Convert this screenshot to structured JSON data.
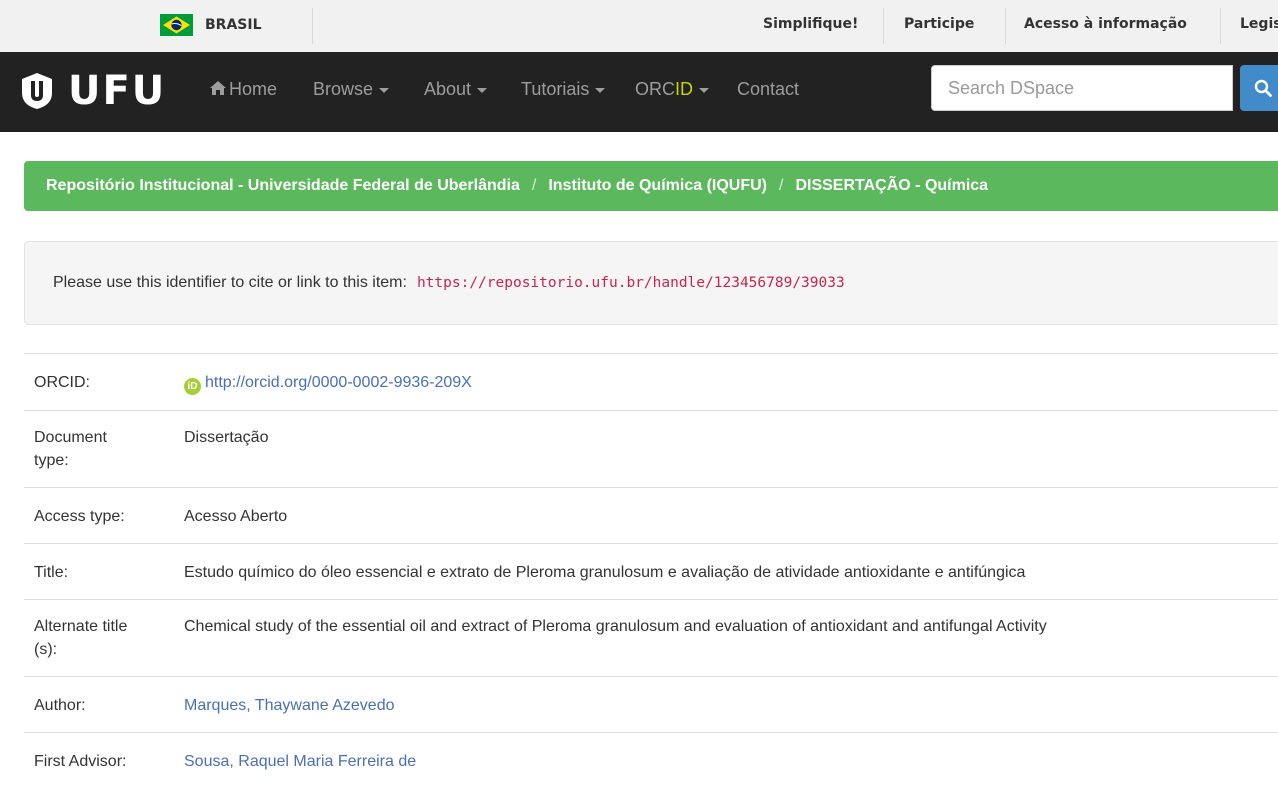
{
  "gov_bar": {
    "country": "BRASIL",
    "links": [
      "Simplifique!",
      "Participe",
      "Acesso à informação",
      "Legislação"
    ]
  },
  "navbar": {
    "logo": "UFU",
    "items": {
      "home": "Home",
      "browse": "Browse",
      "about": "About",
      "tutoriais": "Tutoriais",
      "orcid_prefix": "ORC",
      "orcid_suffix": "ID",
      "contact": "Contact"
    },
    "search_placeholder": "Search DSpace"
  },
  "breadcrumb": {
    "items": [
      "Repositório Institucional - Universidade Federal de Uberlândia",
      "Instituto de Química (IQUFU)",
      "DISSERTAÇÃO - Química"
    ],
    "separator": "/"
  },
  "cite": {
    "text": "Please use this identifier to cite or link to this item:",
    "url": "https://repositorio.ufu.br/handle/123456789/39033"
  },
  "metadata": {
    "orcid": {
      "label": "ORCID:",
      "value": "http://orcid.org/0000-0002-9936-209X"
    },
    "doc_type": {
      "label_line1": "Document",
      "label_line2": "type:",
      "value": "Dissertação"
    },
    "access_type": {
      "label": "Access type:",
      "value": "Acesso Aberto"
    },
    "title": {
      "label": "Title:",
      "value": "Estudo químico do óleo essencial e extrato de Pleroma granulosum e avaliação de atividade antioxidante e antifúngica"
    },
    "alt_title": {
      "label_line1": "Alternate title",
      "label_line2": "(s):",
      "value": "Chemical study of the essential oil and extract of Pleroma granulosum and evaluation of antioxidant and antifungal Activity"
    },
    "author": {
      "label": "Author:",
      "value": "Marques, Thaywane Azevedo"
    },
    "first_advisor": {
      "label": "First Advisor:",
      "value": "Sousa, Raquel Maria Ferreira de"
    }
  },
  "colors": {
    "navbar_bg": "#222222",
    "breadcrumb_bg": "#5cb85c",
    "link": "#4a6fb5",
    "code": "#c7254e",
    "orcid_green": "#a6ce39"
  }
}
